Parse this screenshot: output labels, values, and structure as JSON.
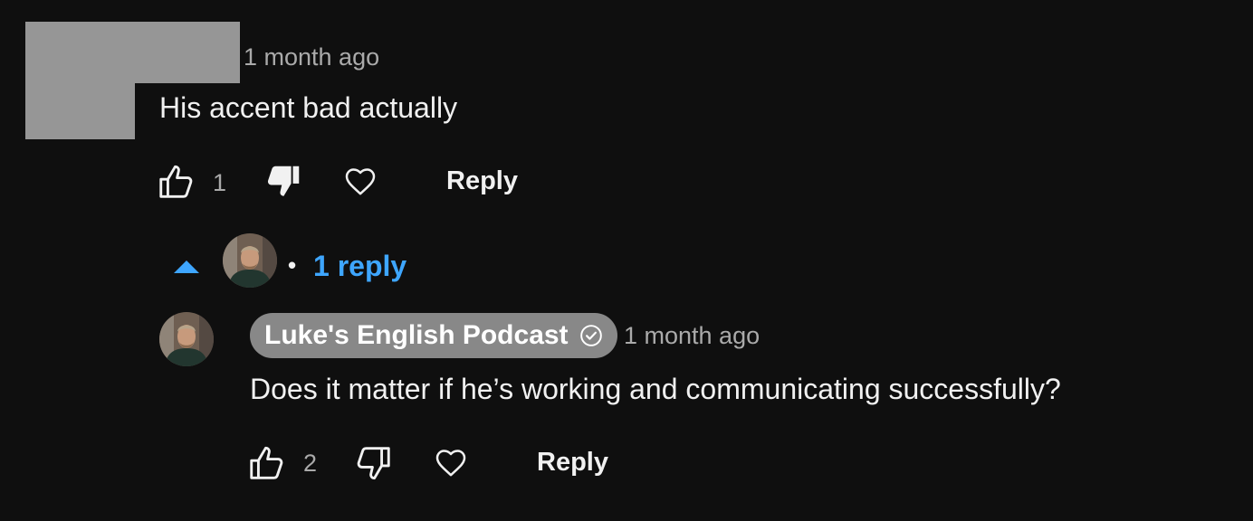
{
  "comment": {
    "timestamp": "1 month ago",
    "text": "His accent bad actually",
    "like_count": "1",
    "reply_label": "Reply",
    "icons": {
      "like": "thumbs-up-outline-icon",
      "dislike": "thumbs-down-filled-icon",
      "heart": "heart-outline-icon"
    }
  },
  "replies_toggle": {
    "label": "1 reply",
    "separator": "•",
    "icon": "caret-up-icon",
    "accent": "#3ea6ff"
  },
  "reply": {
    "author": "Luke's English Podcast",
    "timestamp": "1 month ago",
    "text": "Does it matter if he’s working and communicating successfully?",
    "like_count": "2",
    "reply_label": "Reply",
    "icons": {
      "verified": "verified-check-icon",
      "like": "thumbs-up-outline-icon",
      "dislike": "thumbs-down-outline-icon",
      "heart": "heart-outline-icon"
    }
  },
  "colors": {
    "background": "#0f0f0f",
    "text": "#f1f1f1",
    "secondary_text": "#aaaaaa",
    "author_pill": "#888888"
  }
}
